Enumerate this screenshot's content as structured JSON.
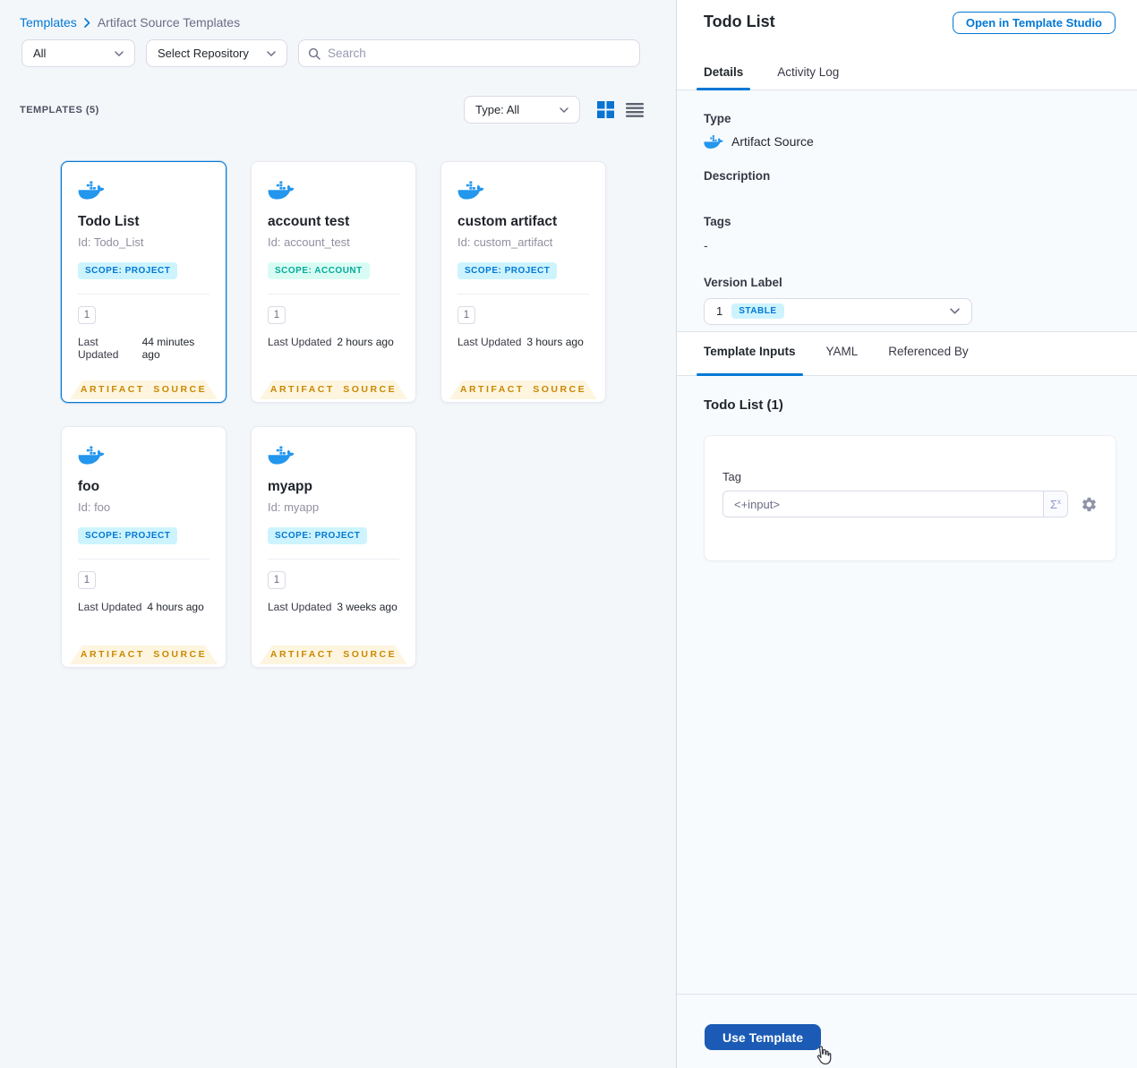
{
  "breadcrumb": {
    "root": "Templates",
    "current": "Artifact Source Templates"
  },
  "filters": {
    "scope": "All",
    "repository": "Select Repository",
    "search_placeholder": "Search"
  },
  "list_header": {
    "count_label": "TEMPLATES (5)",
    "type_filter": "Type: All"
  },
  "card_shared": {
    "last_updated_label": "Last Updated",
    "footer_badge": "ARTIFACT SOURCE"
  },
  "cards": [
    {
      "title": "Todo List",
      "id": "Id: Todo_List",
      "scope": "SCOPE: PROJECT",
      "version": "1",
      "updated": "44 minutes ago"
    },
    {
      "title": "account test",
      "id": "Id: account_test",
      "scope": "SCOPE: ACCOUNT",
      "version": "1",
      "updated": "2 hours ago"
    },
    {
      "title": "custom artifact",
      "id": "Id: custom_artifact",
      "scope": "SCOPE: PROJECT",
      "version": "1",
      "updated": "3 hours ago"
    },
    {
      "title": "foo",
      "id": "Id: foo",
      "scope": "SCOPE: PROJECT",
      "version": "1",
      "updated": "4 hours ago"
    },
    {
      "title": "myapp",
      "id": "Id: myapp",
      "scope": "SCOPE: PROJECT",
      "version": "1",
      "updated": "3 weeks ago"
    }
  ],
  "panel": {
    "title": "Todo List",
    "open_button": "Open in Template Studio",
    "tabs": {
      "details": "Details",
      "activity": "Activity Log"
    },
    "details": {
      "type_label": "Type",
      "type_value": "Artifact Source",
      "description_label": "Description",
      "tags_label": "Tags",
      "tags_value": "-",
      "version_label": "Version Label",
      "version_value": "1",
      "version_badge": "STABLE"
    },
    "inner_tabs": {
      "inputs": "Template Inputs",
      "yaml": "YAML",
      "referenced": "Referenced By"
    },
    "inputs": {
      "heading": "Todo List (1)",
      "tag_label": "Tag",
      "tag_value": "<+input>",
      "expression_symbol": "Σ",
      "expression_sup": "x"
    },
    "footer": {
      "use_template": "Use Template"
    }
  },
  "icons": {
    "docker": "docker-whale",
    "search": "magnifier",
    "breadcrumb_separator": "chevron-right",
    "selects": "chevron-down",
    "view_grid": "grid-2x2",
    "view_list": "list-lines",
    "settings": "gear",
    "expression": "sigma-x",
    "pointer": "hand-cursor"
  },
  "colors": {
    "accent": "#0278d5",
    "docker_blue": "#2396ed",
    "badge_project_bg": "#cdf4fe",
    "badge_project_text": "#0278d5",
    "badge_account_bg": "#d8fcf4",
    "badge_account_text": "#07ab9b",
    "ribbon_bg": "#fdf5df",
    "ribbon_text": "#c98804",
    "primary_button": "#1b5bb5"
  }
}
